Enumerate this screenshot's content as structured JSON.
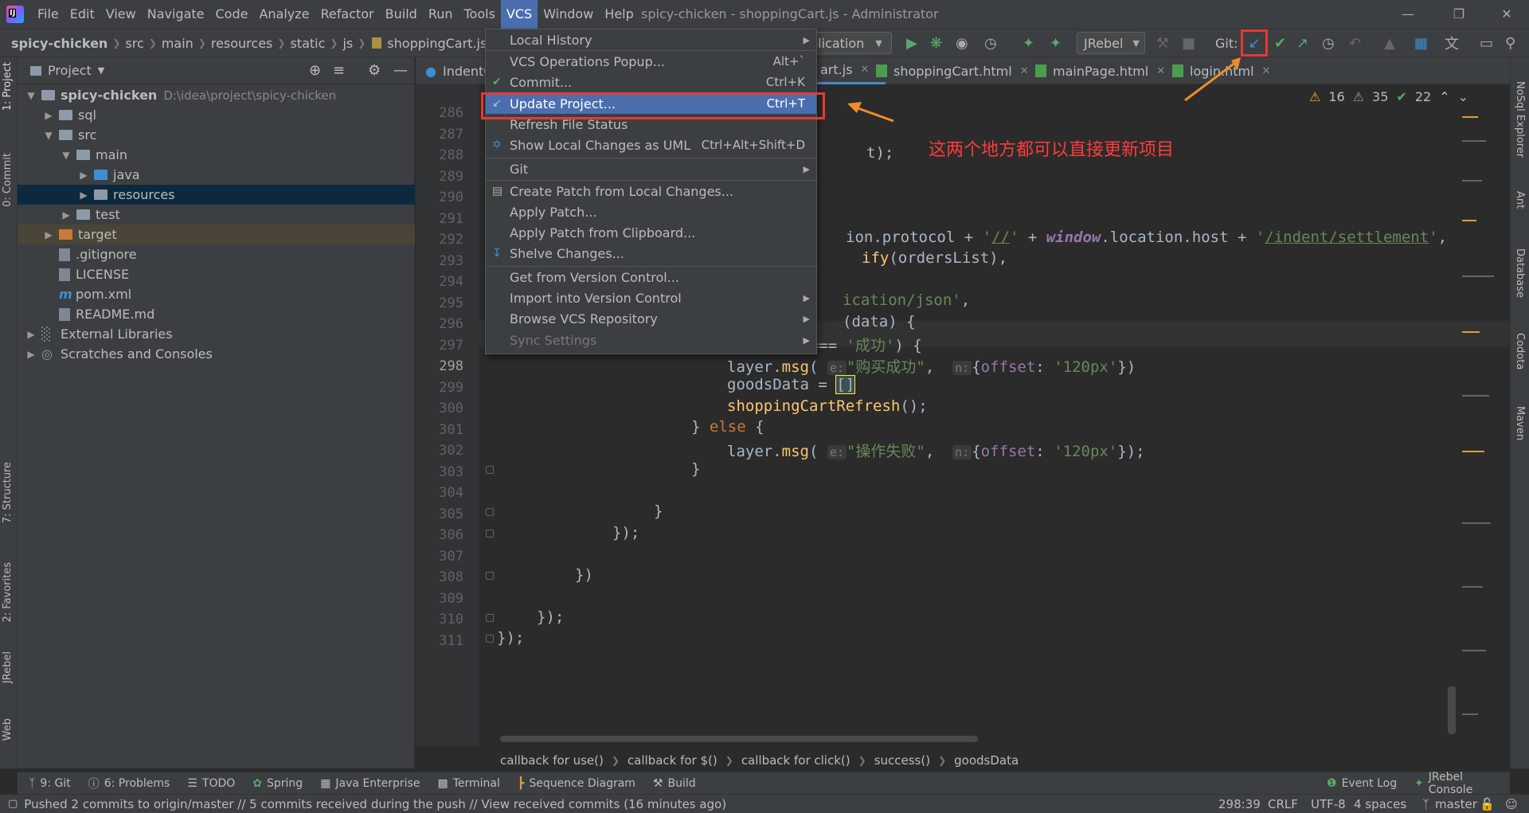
{
  "menubar": {
    "items": [
      "File",
      "Edit",
      "View",
      "Navigate",
      "Code",
      "Analyze",
      "Refactor",
      "Build",
      "Run",
      "Tools",
      "VCS",
      "Window",
      "Help"
    ],
    "title": "spicy-chicken - shoppingCart.js - Administrator"
  },
  "navbar": {
    "crumbs": [
      "spicy-chicken",
      "src",
      "main",
      "resources",
      "static",
      "js",
      "shoppingCart.js"
    ]
  },
  "toolbar": {
    "run_config": "plication",
    "jrebel": "JRebel",
    "git_label": "Git:"
  },
  "left_strip": {
    "project": "1: Project",
    "commit": "0: Commit",
    "structure": "7: Structure",
    "favorites": "2: Favorites",
    "jrebel": "JRebel",
    "web": "Web"
  },
  "right_strip": {
    "nosql": "NoSql Explorer",
    "ant": "Ant",
    "database": "Database",
    "codota": "Codota",
    "maven": "Maven"
  },
  "project": {
    "title": "Project",
    "tree": [
      {
        "label": "spicy-chicken",
        "hint": "D:\\idea\\project\\spicy-chicken"
      },
      {
        "label": "sql"
      },
      {
        "label": "src"
      },
      {
        "label": "main"
      },
      {
        "label": "java"
      },
      {
        "label": "resources"
      },
      {
        "label": "test"
      },
      {
        "label": "target"
      },
      {
        "label": ".gitignore"
      },
      {
        "label": "LICENSE"
      },
      {
        "label": "pom.xml"
      },
      {
        "label": "README.md"
      },
      {
        "label": "External Libraries"
      },
      {
        "label": "Scratches and Consoles"
      }
    ]
  },
  "tabs": [
    "IndentC",
    "art.js",
    "shoppingCart.html",
    "mainPage.html",
    "login.html"
  ],
  "inspections": {
    "warnings": "16",
    "weak": "35",
    "ok": "22"
  },
  "editor": {
    "line_numbers": [
      "286",
      "287",
      "288",
      "289",
      "290",
      "291",
      "292",
      "293",
      "294",
      "295",
      "296",
      "297",
      "298",
      "299",
      "300",
      "301",
      "302",
      "303",
      "304",
      "305",
      "306",
      "307",
      "308",
      "309",
      "310",
      "311"
    ],
    "current_line": "298"
  },
  "editor_crumbs": [
    "callback for use()",
    "callback for $()",
    "callback for click()",
    "success()",
    "goodsData"
  ],
  "vcs_menu": {
    "items": [
      {
        "label": "Local History",
        "submenu": true
      },
      {
        "label": "VCS Operations Popup...",
        "shortcut": "Alt+`"
      },
      {
        "label": "Commit...",
        "shortcut": "Ctrl+K"
      },
      {
        "label": "Update Project...",
        "shortcut": "Ctrl+T"
      },
      {
        "label": "Refresh File Status"
      },
      {
        "label": "Show Local Changes as UML",
        "shortcut": "Ctrl+Alt+Shift+D"
      },
      {
        "label": "Git",
        "submenu": true
      },
      {
        "label": "Create Patch from Local Changes..."
      },
      {
        "label": "Apply Patch..."
      },
      {
        "label": "Apply Patch from Clipboard..."
      },
      {
        "label": "Shelve Changes..."
      },
      {
        "label": "Get from Version Control..."
      },
      {
        "label": "Import into Version Control",
        "submenu": true
      },
      {
        "label": "Browse VCS Repository",
        "submenu": true
      },
      {
        "label": "Sync Settings",
        "submenu": true
      }
    ]
  },
  "annotation": "这两个地方都可以直接更新项目",
  "bottom_tools": [
    "9: Git",
    "6: Problems",
    "TODO",
    "Spring",
    "Java Enterprise",
    "Terminal",
    "Sequence Diagram",
    "Build",
    "Event Log",
    "JRebel Console"
  ],
  "status": {
    "message": "Pushed 2 commits to origin/master // 5 commits received during the push // View received commits (16 minutes ago)",
    "position": "298:39",
    "line_sep": "CRLF",
    "encoding": "UTF-8",
    "indent": "4 spaces",
    "branch": "master"
  },
  "colors": {
    "accent": "#4b6eaf",
    "highlight_box": "#e53935",
    "annotation": "#ff3b3b",
    "arrow": "#f28c28"
  }
}
